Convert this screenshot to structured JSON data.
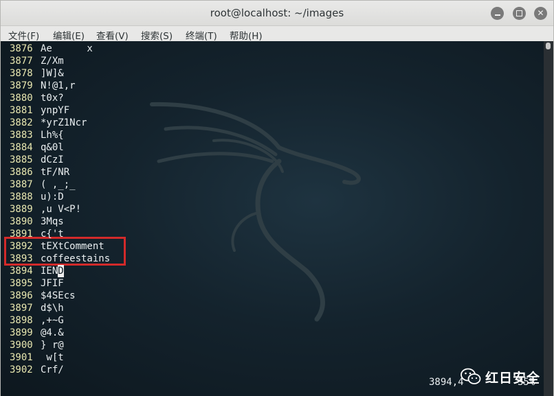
{
  "window": {
    "title": "root@localhost: ~/images",
    "minimize_glyph": "",
    "maximize_glyph": "",
    "close_glyph": "✕"
  },
  "menu": {
    "items": [
      {
        "label": "文件(F)"
      },
      {
        "label": "编辑(E)"
      },
      {
        "label": "查看(V)"
      },
      {
        "label": "搜索(S)"
      },
      {
        "label": "终端(T)"
      },
      {
        "label": "帮助(H)"
      }
    ]
  },
  "terminal": {
    "lines": [
      {
        "num": "3876",
        "text": "Ae      x"
      },
      {
        "num": "3877",
        "text": "Z/Xm"
      },
      {
        "num": "3878",
        "text": "]W]&"
      },
      {
        "num": "3879",
        "text": "N!@1,r"
      },
      {
        "num": "3880",
        "text": "t0x?"
      },
      {
        "num": "3881",
        "text": "ynpYF"
      },
      {
        "num": "3882",
        "text": "*yrZ1Ncr"
      },
      {
        "num": "3883",
        "text": "Lh%{"
      },
      {
        "num": "3884",
        "text": "q&0l"
      },
      {
        "num": "3885",
        "text": "dCzI"
      },
      {
        "num": "3886",
        "text": "tF/NR"
      },
      {
        "num": "3887",
        "text": "( ,_;_"
      },
      {
        "num": "3888",
        "text": "u):D"
      },
      {
        "num": "3889",
        "text": ",u V<P!"
      },
      {
        "num": "3890",
        "text": "3Mqs"
      },
      {
        "num": "3891",
        "text": "c{'t"
      },
      {
        "num": "3892",
        "text": "tEXtComment"
      },
      {
        "num": "3893",
        "text": "coffeestains"
      },
      {
        "num": "3894",
        "text": "IEN",
        "cursor_char": "D"
      },
      {
        "num": "3895",
        "text": "JFIF"
      },
      {
        "num": "3896",
        "text": "$4SEcs"
      },
      {
        "num": "3897",
        "text": "d$\\h"
      },
      {
        "num": "3898",
        "text": ",+~G"
      },
      {
        "num": "3899",
        "text": "@4.&"
      },
      {
        "num": "3900",
        "text": "} r@"
      },
      {
        "num": "3901",
        "text": " w[t"
      },
      {
        "num": "3902",
        "text": "Crf/"
      }
    ],
    "status_position": "3894,4",
    "status_percent": "35%",
    "highlight_color": "#d32a2a"
  },
  "watermark": {
    "icon": "wechat-icon",
    "text": "红日安全"
  }
}
